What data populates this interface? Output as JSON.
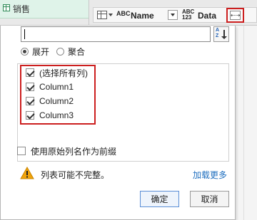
{
  "background": {
    "table_tab_label": "销售",
    "columns": [
      {
        "name": "Name",
        "type_icon": "abc-text-icon"
      },
      {
        "name": "Data",
        "type_icon": "abc123-any-icon"
      }
    ],
    "type_icon_text": {
      "abc": "ABC",
      "abc123_top": "ABC",
      "abc123_bottom": "123"
    },
    "expand_button_icon": "expand-columns-icon"
  },
  "popup": {
    "search": {
      "value": "",
      "placeholder": ""
    },
    "sort_icon_text": "A\nZ",
    "mode_options": [
      {
        "label": "展开",
        "selected": true
      },
      {
        "label": "聚合",
        "selected": false
      }
    ],
    "columns": [
      {
        "label": "(选择所有列)",
        "checked": true
      },
      {
        "label": "Column1",
        "checked": true
      },
      {
        "label": "Column2",
        "checked": true
      },
      {
        "label": "Column3",
        "checked": true
      }
    ],
    "use_prefix": {
      "label": "使用原始列名作为前缀",
      "checked": false
    },
    "warning_text": "列表可能不完整。",
    "load_more_label": "加载更多",
    "ok_label": "确定",
    "cancel_label": "取消"
  },
  "colors": {
    "highlight": "#cc1f1f",
    "link": "#1f6fbf",
    "warning": "#f0a30a",
    "table_tab_bg": "#dff3e9"
  }
}
